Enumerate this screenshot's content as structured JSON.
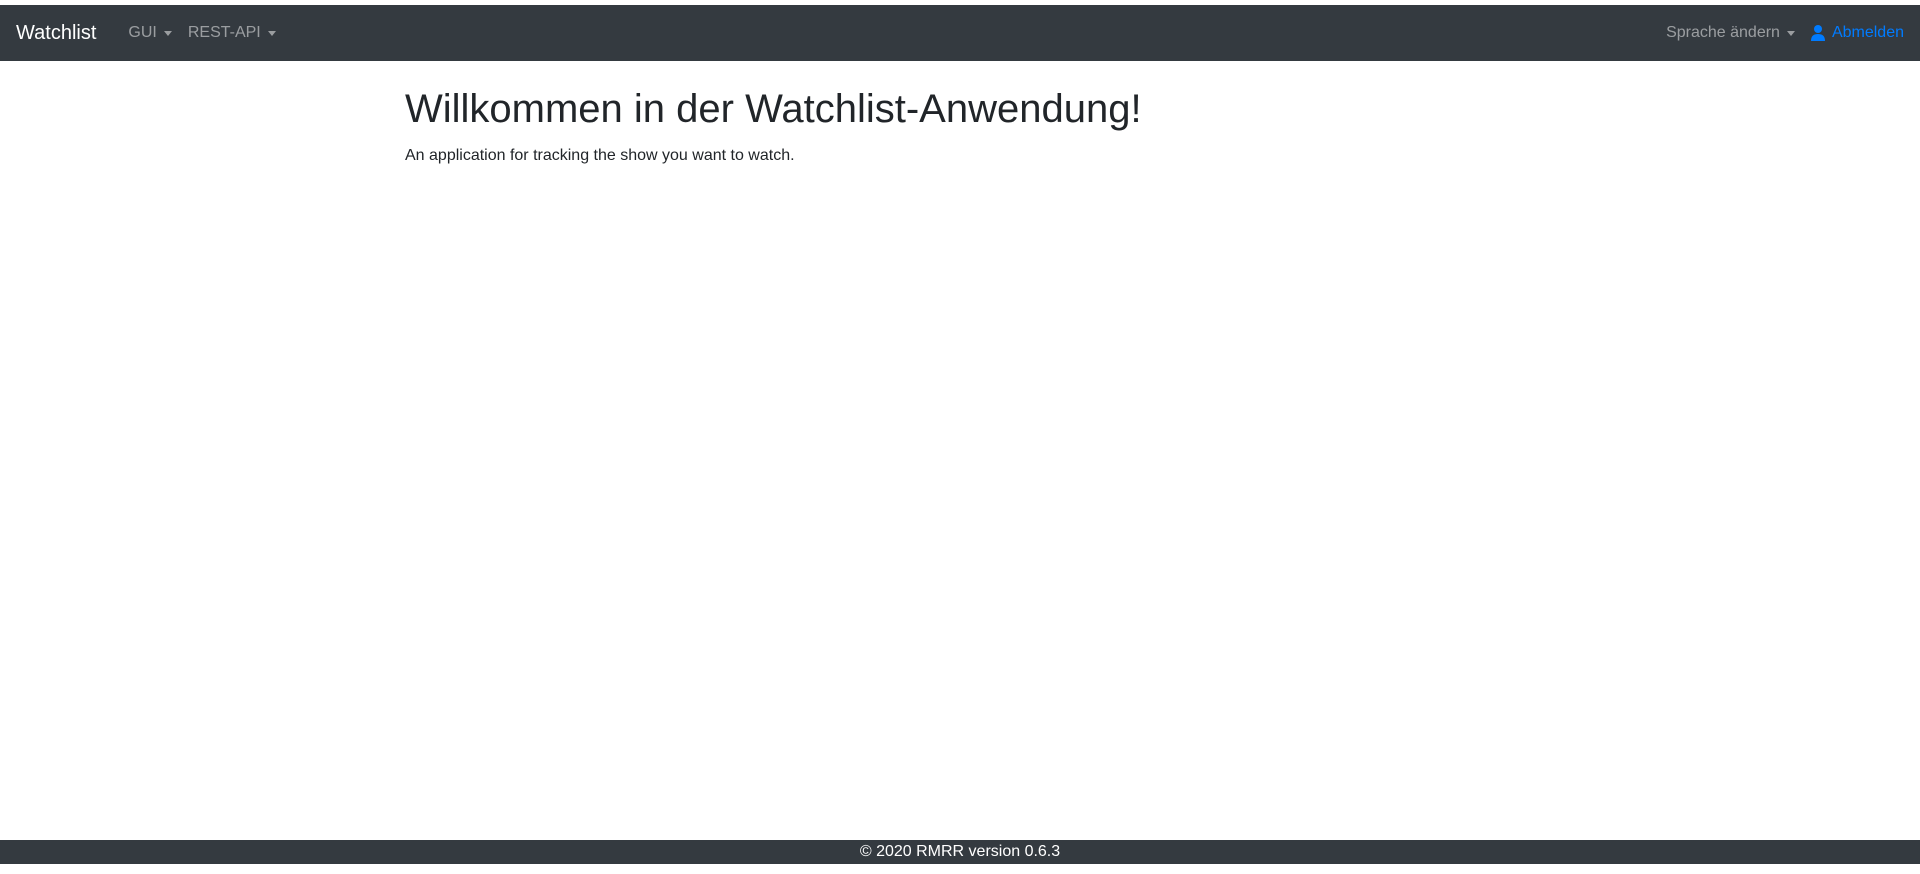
{
  "navbar": {
    "brand": "Watchlist",
    "menus": [
      {
        "label": "GUI"
      },
      {
        "label": "REST-API"
      }
    ],
    "language_label": "Sprache ändern",
    "logout_label": "Abmelden",
    "user_icon": "user-icon",
    "caret_icon": "caret-down-icon"
  },
  "main": {
    "title": "Willkommen in der Watchlist-Anwendung!",
    "subtitle": "An application for tracking the show you want to watch."
  },
  "footer": {
    "text": "© 2020 RMRR version 0.6.3"
  },
  "colors": {
    "navbar_bg": "#343a40",
    "link_active": "#007bff",
    "text": "#212529"
  }
}
